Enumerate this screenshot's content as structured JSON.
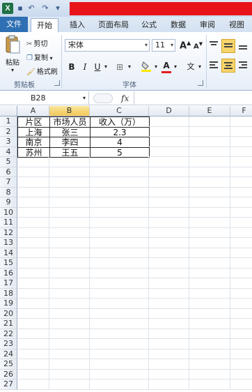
{
  "title_bar": {
    "app_icon": "X"
  },
  "tabs": [
    {
      "label": "文件"
    },
    {
      "label": "开始"
    },
    {
      "label": "插入"
    },
    {
      "label": "页面布局"
    },
    {
      "label": "公式"
    },
    {
      "label": "数据"
    },
    {
      "label": "审阅"
    },
    {
      "label": "视图"
    }
  ],
  "ribbon": {
    "clipboard": {
      "paste": "粘贴",
      "cut": "剪切",
      "copy": "复制",
      "format_painter": "格式刷",
      "group": "剪贴板"
    },
    "font": {
      "name": "宋体",
      "size": "11",
      "bold": "B",
      "italic": "I",
      "underline": "U",
      "grow": "A",
      "shrink": "A",
      "color": "A",
      "phonetic": "文",
      "group": "字体"
    }
  },
  "formula_bar": {
    "name_box": "B28",
    "fx": "fx",
    "value": ""
  },
  "columns": [
    "A",
    "B",
    "C",
    "D",
    "E",
    "F"
  ],
  "rows": [
    "1",
    "2",
    "3",
    "4",
    "5",
    "6",
    "7",
    "8",
    "9",
    "10",
    "11",
    "12",
    "13",
    "14",
    "15",
    "16",
    "17",
    "18",
    "19",
    "20",
    "21",
    "22",
    "23",
    "24",
    "25",
    "26",
    "27"
  ],
  "table": {
    "headers": [
      "片区",
      "市场人员",
      "收入（万）"
    ],
    "rows": [
      [
        "上海",
        "张三",
        "2.3"
      ],
      [
        "南京",
        "李四",
        "4"
      ],
      [
        "苏州",
        "王五",
        "5"
      ]
    ]
  },
  "colors": {
    "file_tab": "#2f6fb3",
    "selected_header": "#f1c75b",
    "redaction": "#e8141a"
  }
}
